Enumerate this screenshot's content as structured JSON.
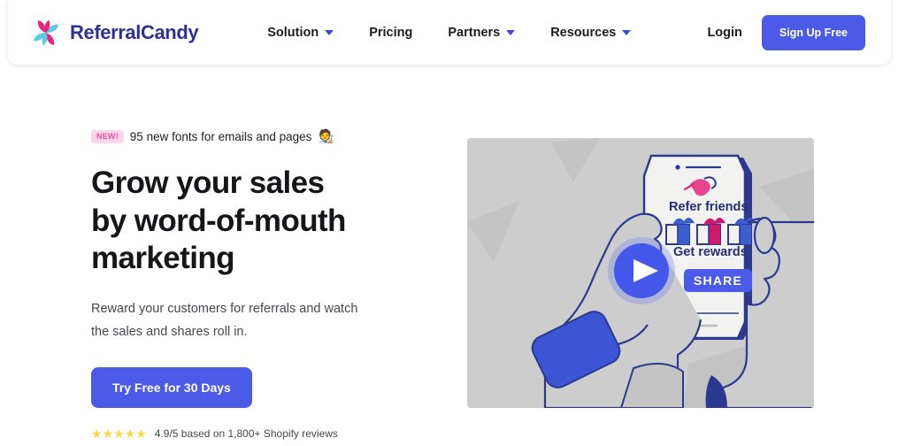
{
  "header": {
    "brand_name": "ReferralCandy",
    "logo_icon": "referralcandy-pinwheel-logo",
    "nav": [
      {
        "label": "Solution",
        "has_dropdown": true,
        "icon": "chevron-down-icon"
      },
      {
        "label": "Pricing",
        "has_dropdown": false,
        "icon": ""
      },
      {
        "label": "Partners",
        "has_dropdown": true,
        "icon": "chevron-down-icon"
      },
      {
        "label": "Resources",
        "has_dropdown": true,
        "icon": "chevron-down-icon"
      }
    ],
    "login_label": "Login",
    "signup_label": "Sign Up Free"
  },
  "hero": {
    "announcement": {
      "badge": "NEW!",
      "text": "95 new fonts for emails and pages",
      "emoji": "🧑‍🎨",
      "emoji_name": "artist-emoji"
    },
    "headline": "Grow your sales by word-of-mouth marketing",
    "subheading": "Reward your customers for referrals and watch the sales and shares roll in.",
    "cta_label": "Try Free for 30 Days",
    "rating": {
      "stars": "★★★★★",
      "star_count": 5,
      "text": "4.9/5 based on 1,800+ Shopify reviews",
      "score": "4.9/5"
    }
  },
  "video": {
    "play_icon": "play-button-icon",
    "alt": "Hands holding a phone showing a referral app",
    "phone_screen": {
      "refer_label": "Refer friends",
      "rewards_label": "Get rewards",
      "share_label": "SHARE",
      "gift_icons": [
        "gift-box-icon",
        "gift-box-icon",
        "gift-box-icon"
      ]
    }
  },
  "colors": {
    "brand_blue": "#4c5ae8",
    "brand_navy": "#2e3192",
    "logo_pink": "#e5267f",
    "logo_cyan": "#5ec8e5",
    "badge_bg": "#fbd5e8",
    "badge_text": "#e7539f",
    "star_gold": "#f7d94c",
    "video_bg": "#cdcdcd",
    "page_bg": "#ffffff"
  }
}
